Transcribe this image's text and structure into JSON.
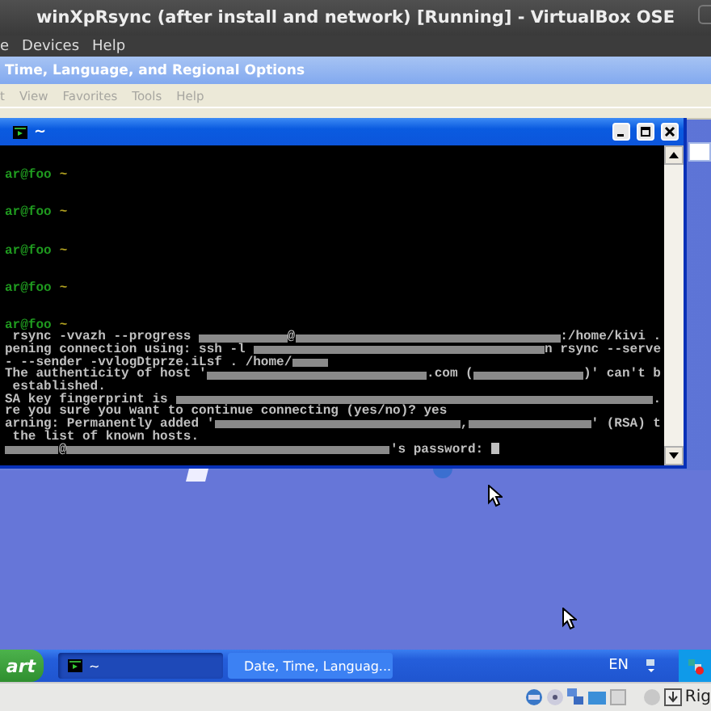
{
  "vbox": {
    "title": "winXpRsync (after install and network) [Running] - VirtualBox OSE",
    "menu": [
      "e",
      "Devices",
      "Help"
    ]
  },
  "explorer": {
    "title": "Time, Language, and Regional Options",
    "menu": [
      "t",
      "View",
      "Favorites",
      "Tools",
      "Help"
    ]
  },
  "console": {
    "title": "~",
    "lines": [
      {
        "kind": "blank"
      },
      {
        "kind": "blank"
      },
      {
        "kind": "prompt",
        "user": "ar@foo",
        "dir": "~"
      },
      {
        "kind": "blank"
      },
      {
        "kind": "blank"
      },
      {
        "kind": "prompt",
        "user": "ar@foo",
        "dir": "~"
      },
      {
        "kind": "blank"
      },
      {
        "kind": "blank"
      },
      {
        "kind": "prompt",
        "user": "ar@foo",
        "dir": "~"
      },
      {
        "kind": "blank"
      },
      {
        "kind": "blank"
      },
      {
        "kind": "prompt",
        "user": "ar@foo",
        "dir": "~"
      },
      {
        "kind": "blank"
      },
      {
        "kind": "blank"
      },
      {
        "kind": "prompt",
        "user": "ar@foo",
        "dir": "~"
      },
      {
        "kind": "text",
        "segments": [
          {
            "kind": "text",
            "text": " rsync -vvazh --progress "
          },
          {
            "kind": "redacted"
          },
          {
            "kind": "text",
            "text": "@"
          },
          {
            "kind": "redacted"
          },
          {
            "kind": "redacted"
          },
          {
            "kind": "redacted"
          },
          {
            "kind": "text",
            "text": ":/home/kivi ."
          }
        ]
      },
      {
        "kind": "text",
        "segments": [
          {
            "kind": "text",
            "text": "pening connection using: ssh -l "
          },
          {
            "kind": "redacted"
          },
          {
            "kind": "redacted"
          },
          {
            "kind": "redacted"
          },
          {
            "kind": "redacted"
          },
          {
            "kind": "text",
            "text": "n rsync --serve"
          }
        ]
      },
      {
        "kind": "text",
        "segments": [
          {
            "kind": "text",
            "text": "- --sender -vvlogDtprze.iLsf . /home/"
          },
          {
            "kind": "redacted"
          },
          {
            "kind": "filler"
          },
          {
            "kind": "filler"
          },
          {
            "kind": "filler"
          }
        ]
      },
      {
        "kind": "text",
        "segments": [
          {
            "kind": "text",
            "text": "The authenticity of host '"
          },
          {
            "kind": "redacted"
          },
          {
            "kind": "redacted"
          },
          {
            "kind": "text",
            "text": ".com ("
          },
          {
            "kind": "redacted"
          },
          {
            "kind": "text",
            "text": ")' can't b"
          }
        ]
      },
      {
        "kind": "text",
        "segments": [
          {
            "kind": "text",
            "text": " established."
          }
        ]
      },
      {
        "kind": "text",
        "segments": [
          {
            "kind": "text",
            "text": "SA key fingerprint is "
          },
          {
            "kind": "redacted"
          },
          {
            "kind": "text",
            "text": "."
          }
        ]
      },
      {
        "kind": "text",
        "segments": [
          {
            "kind": "text",
            "text": "re you sure you want to continue connecting (yes/no)? yes"
          }
        ]
      },
      {
        "kind": "text",
        "segments": [
          {
            "kind": "text",
            "text": "arning: Permanently added '"
          },
          {
            "kind": "redacted"
          },
          {
            "kind": "redacted"
          },
          {
            "kind": "text",
            "text": ","
          },
          {
            "kind": "redacted"
          },
          {
            "kind": "text",
            "text": "' (RSA) t"
          }
        ]
      },
      {
        "kind": "text",
        "segments": [
          {
            "kind": "text",
            "text": " the list of known hosts."
          }
        ]
      },
      {
        "kind": "text",
        "segments": [
          {
            "kind": "redacted"
          },
          {
            "kind": "text",
            "text": "@"
          },
          {
            "kind": "redacted"
          },
          {
            "kind": "redacted"
          },
          {
            "kind": "redacted"
          },
          {
            "kind": "redacted"
          },
          {
            "kind": "redacted"
          },
          {
            "kind": "redacted"
          },
          {
            "kind": "text",
            "text": "'s password: "
          },
          {
            "kind": "cursor"
          },
          {
            "kind": "filler"
          }
        ]
      }
    ]
  },
  "taskbar": {
    "start": "art",
    "tasks": [
      {
        "label": "~",
        "selected": true,
        "kind": "console"
      },
      {
        "label": "Date, Time, Languag...",
        "selected": false,
        "kind": "folder"
      }
    ],
    "language": "EN"
  },
  "status_bar": {
    "host_key": "Rig"
  }
}
